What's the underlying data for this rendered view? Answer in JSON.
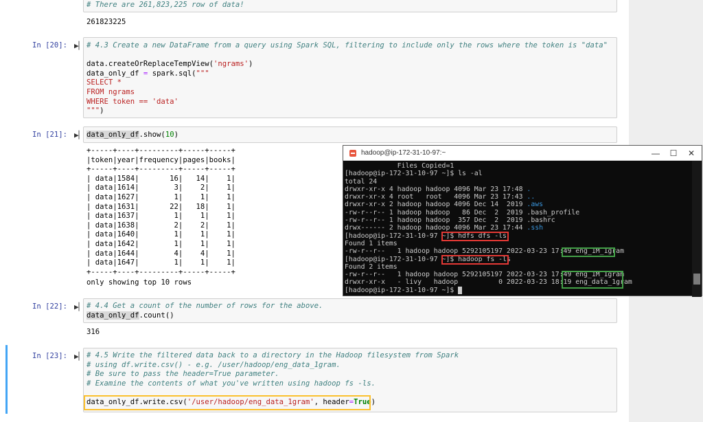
{
  "cell_prev": {
    "comment": "# There are 261,823,225 row of data!",
    "output": "261823225"
  },
  "cell20": {
    "prompt": "In [20]:",
    "comment": "# 4.3 Create a new DataFrame from a query using Spark SQL, filtering to include only the rows where the token is \"data\"",
    "line1a": "data.createOrReplaceTempView(",
    "line1b": "'ngrams'",
    "line1c": ")",
    "line2a": "data_only_df ",
    "line2b": "=",
    "line2c": " spark.sql(",
    "line2d": "\"\"\"",
    "line3": "SELECT *",
    "line4": "FROM ngrams",
    "line5": "WHERE token == 'data'",
    "line6": "\"\"\"",
    "line6b": ")"
  },
  "cell21": {
    "prompt": "In [21]:",
    "code_a": "data_only_df",
    "code_b": ".show(",
    "code_c": "10",
    "code_d": ")",
    "table_text": "+-----+----+---------+-----+-----+\n|token|year|frequency|pages|books|\n+-----+----+---------+-----+-----+\n| data|1584|       16|   14|    1|\n| data|1614|        3|    2|    1|\n| data|1627|        1|    1|    1|\n| data|1631|       22|   18|    1|\n| data|1637|        1|    1|    1|\n| data|1638|        2|    2|    1|\n| data|1640|        1|    1|    1|\n| data|1642|        1|    1|    1|\n| data|1644|        4|    4|    1|\n| data|1647|        1|    1|    1|\n+-----+----+---------+-----+-----+",
    "footer": "only showing top 10 rows"
  },
  "cell22": {
    "prompt": "In [22]:",
    "comment": "# 4.4 Get a count of the number of rows for the above.",
    "code_a": "data_only_df",
    "code_b": ".count()",
    "output": "316"
  },
  "cell23": {
    "prompt": "In [23]:",
    "c1": "# 4.5 Write the filtered data back to a directory in the Hadoop filesystem from Spark",
    "c2": "# using df.write.csv() - e.g. /user/hadoop/eng_data_1gram.",
    "c3": "# Be sure to pass the header=True parameter.",
    "c4": "# Examine the contents of what you've written using hadoop fs -ls.",
    "code_a": "data_only_df.write.csv(",
    "code_b": "'/user/hadoop/eng_data_1gram'",
    "code_c": ", header",
    "code_d": "=",
    "code_e": "True",
    "code_f": ")"
  },
  "terminal": {
    "title": "hadoop@ip-172-31-10-97:~",
    "l01": "             Files Copied=1",
    "l02": "[hadoop@ip-172-31-10-97 ~]$ ls -al",
    "l03": "total 24",
    "l04a": "drwxr-xr-x 4 hadoop hadoop 4096 Mar 23 17:48 ",
    "l04b": ".",
    "l05a": "drwxr-xr-x 4 root   root   4096 Mar 23 17:43 ",
    "l05b": "..",
    "l06a": "drwxr-xr-x 2 hadoop hadoop 4096 Dec 14  2019 ",
    "l06b": ".aws",
    "l07": "-rw-r--r-- 1 hadoop hadoop   86 Dec  2  2019 .bash_profile",
    "l08": "-rw-r--r-- 1 hadoop hadoop  357 Dec  2  2019 .bashrc",
    "l09a": "drwx------ 2 hadoop hadoop 4096 Mar 23 17:44 ",
    "l09b": ".ssh",
    "l10a": "[hadoop@ip-172-31-10-97 ~]",
    "l10b": "$ hdfs dfs -ls",
    "l11": "Found 1 items",
    "l12a": "-rw-r--r--   1 hadoop hadoop 5292105197 2022-03-23 17:49 ",
    "l12b": "eng_1M_1gram",
    "l13a": "[hadoop@ip-172-31-10-97 ~]",
    "l13b": "$ hadoop fs -ls",
    "l14": "Found 2 items",
    "l15a": "-rw-r--r--   1 hadoop hadoop 5292105197 2022-03-23 17:49 ",
    "l15b": "eng_1M_1gram",
    "l16a": "drwxr-xr-x   - livy   hadoop          0 2022-03-23 18:19 ",
    "l16b": "eng_data_1gram",
    "l17": "[hadoop@ip-172-31-10-97 ~]$ "
  },
  "run_glyph": "▶▏",
  "window_buttons": {
    "minimize": "—",
    "maximize": "☐",
    "close": "✕"
  }
}
